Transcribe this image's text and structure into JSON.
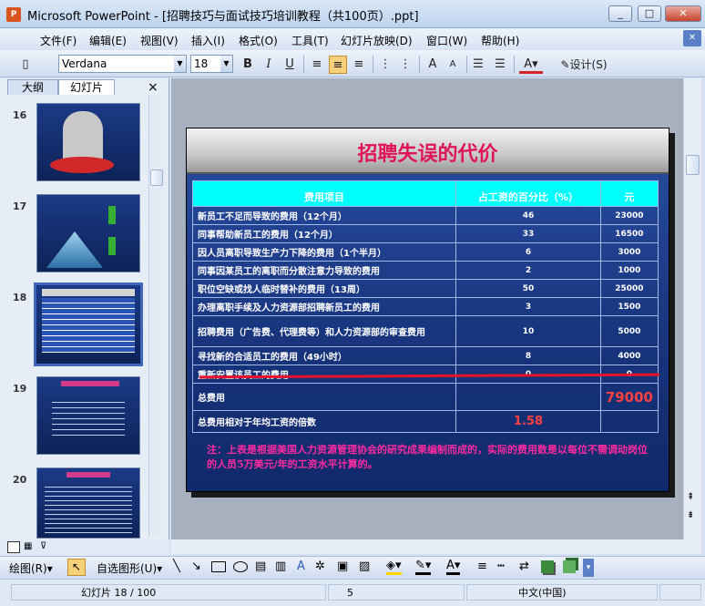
{
  "window": {
    "title": "Microsoft PowerPoint - [招聘技巧与面试技巧培训教程（共100页）.ppt]",
    "minimize": "_",
    "maximize": "□",
    "close": "✕"
  },
  "menu": [
    "文件(F)",
    "编辑(E)",
    "视图(V)",
    "插入(I)",
    "格式(O)",
    "工具(T)",
    "幻灯片放映(D)",
    "窗口(W)",
    "帮助(H)"
  ],
  "toolbar": {
    "font": "Verdana",
    "size": "18",
    "bold": "B",
    "italic": "I",
    "underline": "U",
    "design": "设计(S)"
  },
  "panel": {
    "tabs": [
      "大纲",
      "幻灯片"
    ],
    "close": "×",
    "slides": [
      {
        "num": "16"
      },
      {
        "num": "17"
      },
      {
        "num": "18"
      },
      {
        "num": "19"
      },
      {
        "num": "20"
      }
    ]
  },
  "slide": {
    "title": "招聘失误的代价",
    "headers": [
      "费用项目",
      "占工资的百分比（%）",
      "元"
    ],
    "rows": [
      [
        "新员工不足而导致的费用（12个月）",
        "46",
        "23000"
      ],
      [
        "同事帮助新员工的费用（12个月）",
        "33",
        "16500"
      ],
      [
        "因人员离职导致生产力下降的费用（1个半月）",
        "6",
        "3000"
      ],
      [
        "同事因某员工的离职而分散注意力导致的费用",
        "2",
        "1000"
      ],
      [
        "职位空缺或找人临时替补的费用（13周）",
        "50",
        "25000"
      ],
      [
        "办理离职手续及人力资源部招聘新员工的费用",
        "3",
        "1500"
      ],
      [
        "招聘费用（广告费、代理费等）和人力资源部的审查费用",
        "10",
        "5000"
      ],
      [
        "寻找新的合适员工的费用（49小时）",
        "8",
        "4000"
      ],
      [
        "重新安置该员工的费用",
        "0",
        "0"
      ]
    ],
    "total_label": "总费用",
    "total_value": "79000",
    "ratio_label": "总费用相对于年均工资的倍数",
    "ratio_value": "1.58",
    "note": "注：上表是根据美国人力资源管理协会的研究成果编制而成的，实际的费用数是以每位不需调动岗位的人员5万美元/年的工资水平计算的。"
  },
  "drawbar": {
    "draw": "绘图(R)",
    "autoshape": "自选图形(U)"
  },
  "status": {
    "slide": "幻灯片 18 / 100",
    "page": "5",
    "lang": "中文(中国)"
  }
}
